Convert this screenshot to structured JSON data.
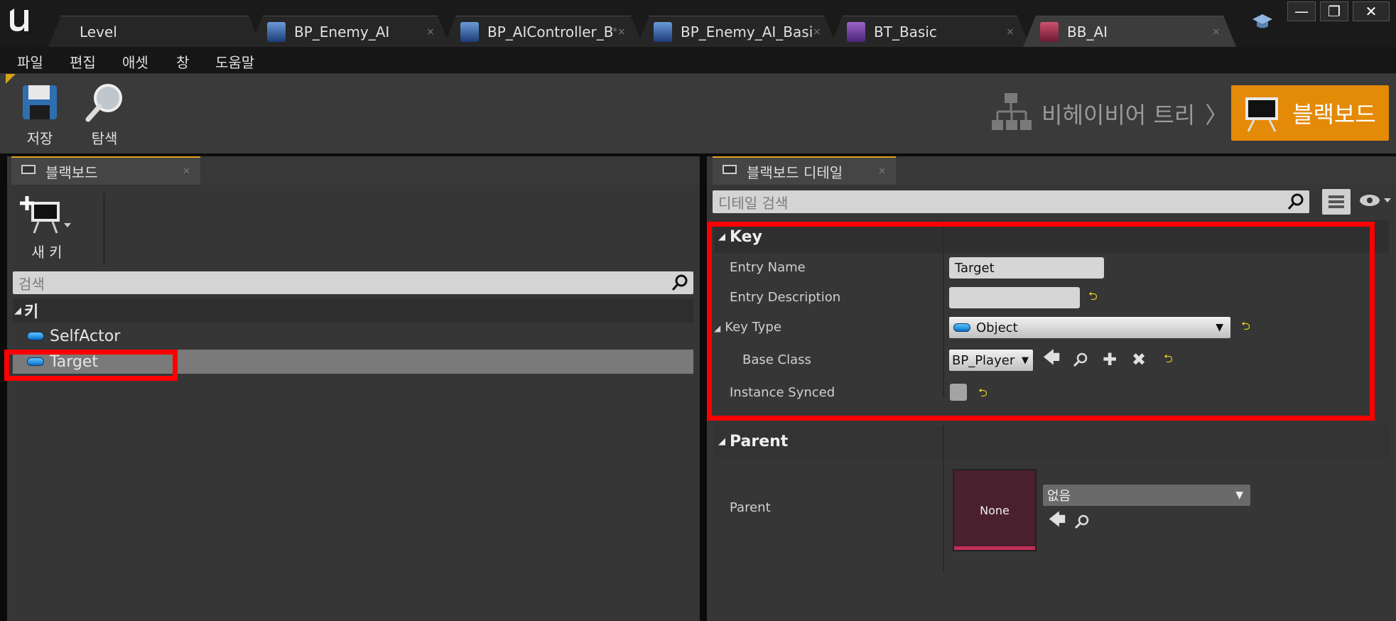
{
  "tabs": [
    {
      "label": "Level",
      "icon": "level-icon"
    },
    {
      "label": "BP_Enemy_AI",
      "icon": "blueprint-icon",
      "close": "×"
    },
    {
      "label": "BP_AIController_Ba",
      "icon": "blueprint-controller-icon",
      "close": "*×"
    },
    {
      "label": "BP_Enemy_AI_Basic",
      "icon": "blueprint-icon",
      "close": "×"
    },
    {
      "label": "BT_Basic",
      "icon": "behavior-tree-icon",
      "close": "×"
    },
    {
      "label": "BB_AI",
      "icon": "blackboard-icon",
      "close": "×"
    }
  ],
  "window_buttons": {
    "minimize": "—",
    "maximize": "❐",
    "close": "✕"
  },
  "menu": [
    "파일",
    "편집",
    "애셋",
    "창",
    "도움말"
  ],
  "toolbar": {
    "save_label": "저장",
    "browse_label": "탐색"
  },
  "mode": {
    "behavior_tree": "비헤이비어 트리",
    "separator": "〉",
    "blackboard": "블랙보드"
  },
  "left_panel": {
    "tab_label": "블랙보드",
    "new_key_label": "새 키",
    "search_placeholder": "검색",
    "category": "키",
    "keys": [
      "SelfActor",
      "Target"
    ],
    "selected_key": "Target"
  },
  "right_panel": {
    "tab_label": "블랙보드 디테일",
    "search_placeholder": "디테일 검색",
    "key_section": {
      "title": "Key",
      "entry_name_label": "Entry Name",
      "entry_name_value": "Target",
      "entry_description_label": "Entry Description",
      "entry_description_value": "",
      "key_type_label": "Key Type",
      "key_type_value": "Object",
      "base_class_label": "Base Class",
      "base_class_value": "BP_Player",
      "instance_synced_label": "Instance Synced"
    },
    "parent_section": {
      "title": "Parent",
      "parent_label": "Parent",
      "thumbnail_text": "None",
      "parent_value": "없음"
    }
  },
  "colors": {
    "accent_orange": "#e38a06",
    "highlight_red": "#ff0000",
    "selection": "#7a7a7a",
    "reset_yellow": "#e6d21a"
  }
}
